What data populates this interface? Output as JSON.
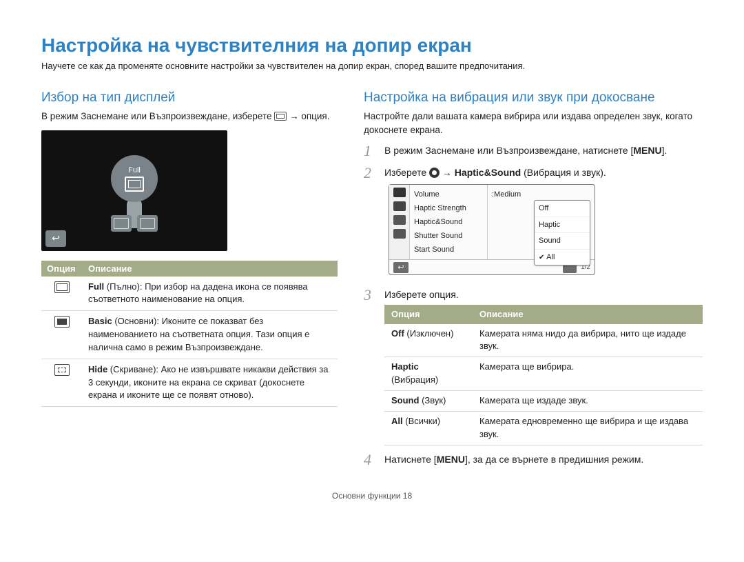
{
  "page_title": "Настройка на чувствителния на допир екран",
  "page_sub": "Научете се как да променяте основните настройки за чувствителен на допир екран, според вашите предпочитания.",
  "left": {
    "heading": "Избор на тип дисплей",
    "intro_pre": "В режим Заснемане или Възпроизвеждане, изберете ",
    "intro_post": " → опция.",
    "screenshot_label": "Full",
    "back_glyph": "↩",
    "th_option": "Опция",
    "th_desc": "Описание",
    "rows": [
      {
        "name": "Full",
        "local": "(Пълно)",
        "desc": ": При избор на дадена икона се появява съответното наименование на опция."
      },
      {
        "name": "Basic",
        "local": "(Основни)",
        "desc": ": Иконите се показват без наименованието на съответната опция. Тази опция е налична само в режим Възпроизвеждане."
      },
      {
        "name": "Hide",
        "local": "(Скриване)",
        "desc": ": Ако не извършвате никакви действия за 3 секунди, иконите на екрана се скриват (докоснете екрана и иконите ще се появят отново)."
      }
    ]
  },
  "right": {
    "heading": "Настройка на вибрация или звук при докосване",
    "intro": "Настройте дали вашата камера вибрира или издава определен звук, когато докоснете екрана.",
    "steps": {
      "s1_a": "В режим Заснемане или Възпроизвеждане, натиснете [",
      "s1_menu": "MENU",
      "s1_b": "].",
      "s2_a": "Изберете ",
      "s2_b": " → ",
      "s2_haptic": "Haptic&Sound",
      "s2_c": " (Вибрация и звук).",
      "s3": "Изберете опция.",
      "s4_a": "Натиснете [",
      "s4_menu": "MENU",
      "s4_b": "], за да се върнете в предишния режим."
    },
    "menu": {
      "labels": [
        "Volume",
        "Haptic Strength",
        "Haptic&Sound",
        "Shutter Sound",
        "Start Sound"
      ],
      "value0": ":Medium",
      "popup": [
        "Off",
        "Haptic",
        "Sound"
      ],
      "popup_checked": "All",
      "back_glyph": "↩",
      "up_glyph": "ˆ",
      "pager": "1/2"
    },
    "th_option": "Опция",
    "th_desc": "Описание",
    "rows": [
      {
        "name": "Off",
        "local": "(Изключен)",
        "desc": "Камерата няма нидо да вибрира, нито ще издаде звук."
      },
      {
        "name": "Haptic",
        "local": "(Вибрация)",
        "desc": "Камерата ще вибрира."
      },
      {
        "name": "Sound",
        "local": "(Звук)",
        "desc": "Камерата ще издаде звук."
      },
      {
        "name": "All",
        "local": "(Всички)",
        "desc": "Камерата едновременно ще вибрира и ще издава звук."
      }
    ]
  },
  "footer": "Основни функции  18"
}
